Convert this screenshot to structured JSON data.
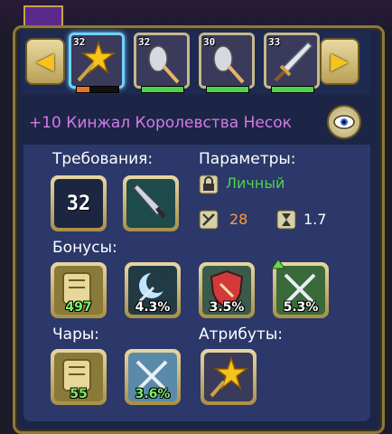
{
  "item_bar": {
    "left_arrow": "◀",
    "right_arrow": "▶",
    "slots": [
      {
        "level": "32",
        "icon": "star-weapon-icon",
        "bar_fill": 0.3,
        "bar_color": "#e8752a",
        "selected": true
      },
      {
        "level": "32",
        "icon": "shovel-icon",
        "bar_fill": 1.0,
        "bar_color": "#4fd34f",
        "selected": false
      },
      {
        "level": "30",
        "icon": "shovel-icon",
        "bar_fill": 1.0,
        "bar_color": "#4fd34f",
        "selected": false
      },
      {
        "level": "33",
        "icon": "dagger-icon",
        "bar_fill": 1.0,
        "bar_color": "#4fd34f",
        "selected": false
      }
    ]
  },
  "item": {
    "name": "+10 Кинжал Королевства Несок",
    "name_color": "#d27be8"
  },
  "requirements": {
    "label": "Требования:",
    "level": "32",
    "class_icon": "dagger-class-icon"
  },
  "params": {
    "label": "Параметры:",
    "binding": "Личный",
    "binding_color": "#4fd34f",
    "damage": "28",
    "speed": "1.7"
  },
  "bonuses": {
    "label": "Бонусы:",
    "items": [
      {
        "icon": "scroll-icon",
        "value": "497"
      },
      {
        "icon": "moon-strike-icon",
        "value": "4.3%"
      },
      {
        "icon": "shield-crit-icon",
        "value": "3.5%"
      },
      {
        "icon": "crossed-swords-icon",
        "value": "5.3%"
      }
    ]
  },
  "enchants": {
    "label": "Чары:",
    "items": [
      {
        "icon": "scroll-icon",
        "value": "55"
      },
      {
        "icon": "crossed-swords-icon",
        "value": "3.6%"
      }
    ]
  },
  "attributes": {
    "label": "Атрибуты:",
    "icon": "star-attribute-icon"
  },
  "colors": {
    "value_green": "#7cf06a",
    "damage_orange": "#ff9a3c",
    "label_white": "#ffffff"
  }
}
